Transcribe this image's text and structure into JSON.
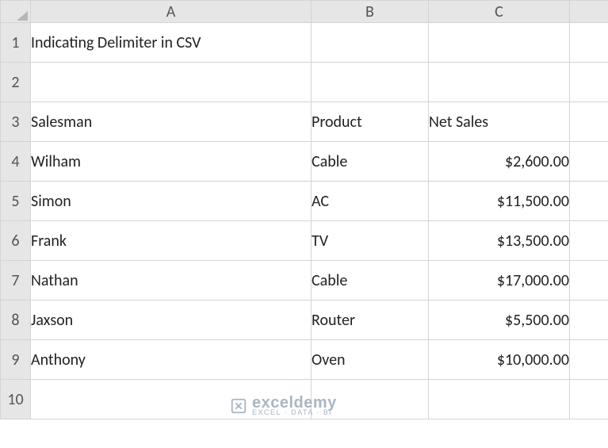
{
  "columns": [
    "A",
    "B",
    "C",
    ""
  ],
  "row_numbers": [
    "1",
    "2",
    "3",
    "4",
    "5",
    "6",
    "7",
    "8",
    "9",
    "10"
  ],
  "rows": [
    {
      "A": "Indicating Delimiter in CSV",
      "B": "",
      "C": ""
    },
    {
      "A": "",
      "B": "",
      "C": ""
    },
    {
      "A": "Salesman",
      "B": "Product",
      "C": "Net Sales"
    },
    {
      "A": "Wilham",
      "B": "Cable",
      "C": "$2,600.00"
    },
    {
      "A": "Simon",
      "B": "AC",
      "C": "$11,500.00"
    },
    {
      "A": "Frank",
      "B": "TV",
      "C": "$13,500.00"
    },
    {
      "A": "Nathan",
      "B": "Cable",
      "C": "$17,000.00"
    },
    {
      "A": "Jaxson",
      "B": "Router",
      "C": "$5,500.00"
    },
    {
      "A": "Anthony",
      "B": "Oven",
      "C": "$10,000.00"
    },
    {
      "A": "",
      "B": "",
      "C": ""
    }
  ],
  "numeric_col_c_from_row_index": 3,
  "watermark": {
    "brand": "exceldemy",
    "tagline": "EXCEL · DATA · BI"
  }
}
